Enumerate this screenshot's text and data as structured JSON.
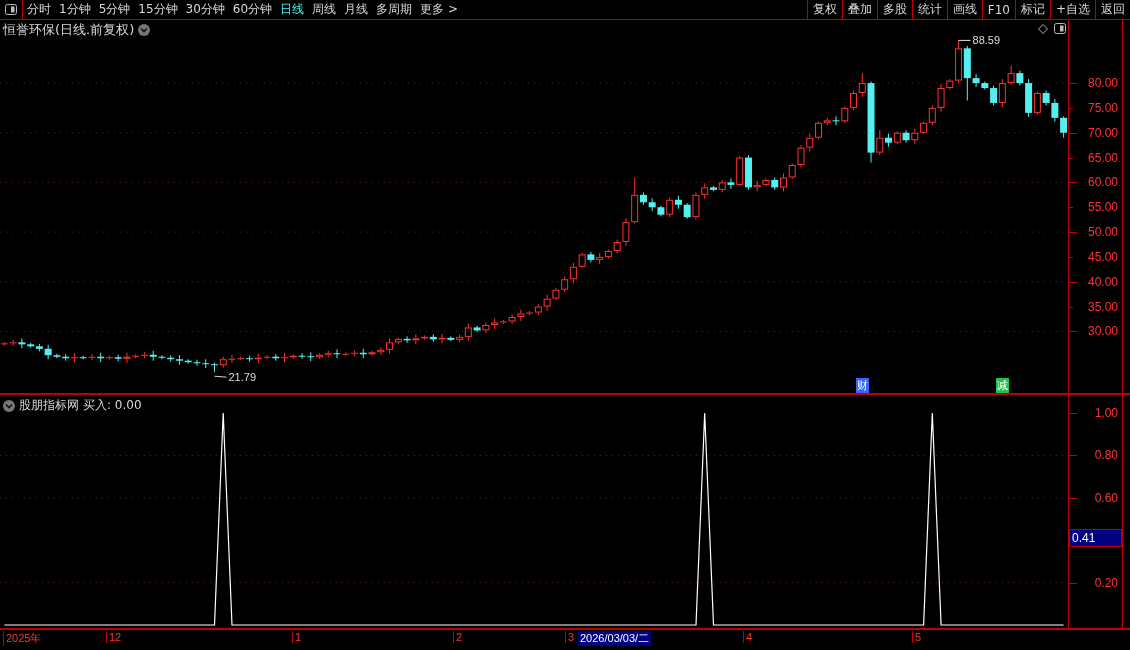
{
  "toolbar": {
    "periods": [
      {
        "label": "分时",
        "selected": false
      },
      {
        "label": "1分钟",
        "selected": false
      },
      {
        "label": "5分钟",
        "selected": false
      },
      {
        "label": "15分钟",
        "selected": false
      },
      {
        "label": "30分钟",
        "selected": false
      },
      {
        "label": "60分钟",
        "selected": false
      },
      {
        "label": "日线",
        "selected": true
      },
      {
        "label": "周线",
        "selected": false
      },
      {
        "label": "月线",
        "selected": false
      },
      {
        "label": "多周期",
        "selected": false
      },
      {
        "label": "更多 >",
        "selected": false
      }
    ],
    "buttons": [
      "复权",
      "叠加",
      "多股",
      "统计",
      "画线",
      "F10",
      "标记",
      "+自选",
      "返回"
    ]
  },
  "price_panel": {
    "title": "恒誉环保(日线.前复权)",
    "chart_data": {
      "type": "candlestick",
      "ylim": [
        17.6,
        92.7
      ],
      "yticks": [
        {
          "value": 80,
          "label": "80.00"
        },
        {
          "value": 75,
          "label": "75.00"
        },
        {
          "value": 70,
          "label": "70.00"
        },
        {
          "value": 65,
          "label": "65.00"
        },
        {
          "value": 60,
          "label": "60.00"
        },
        {
          "value": 55,
          "label": "55.00"
        },
        {
          "value": 50,
          "label": "50.00"
        },
        {
          "value": 45,
          "label": "45.00"
        },
        {
          "value": 40,
          "label": "40.00"
        },
        {
          "value": 35,
          "label": "35.00"
        },
        {
          "value": 30,
          "label": "30.00"
        }
      ],
      "grid": true,
      "ohlc": [
        [
          27.4,
          27.9,
          27.1,
          27.6
        ],
        [
          27.6,
          28.3,
          27.1,
          27.8
        ],
        [
          27.8,
          28.6,
          26.6,
          27.4
        ],
        [
          27.4,
          27.7,
          26.7,
          27.0
        ],
        [
          27.0,
          27.5,
          26.0,
          26.5
        ],
        [
          26.5,
          27.3,
          24.4,
          25.2
        ],
        [
          25.2,
          25.5,
          24.6,
          24.9
        ],
        [
          24.9,
          25.4,
          24.1,
          24.6
        ],
        [
          24.6,
          25.6,
          23.8,
          24.8
        ],
        [
          24.8,
          25.1,
          24.4,
          24.7
        ],
        [
          24.7,
          25.4,
          24.2,
          24.9
        ],
        [
          24.9,
          25.7,
          23.8,
          24.6
        ],
        [
          24.6,
          25.1,
          24.3,
          24.8
        ],
        [
          24.8,
          25.3,
          24.0,
          24.5
        ],
        [
          24.5,
          25.7,
          23.7,
          24.9
        ],
        [
          24.9,
          25.4,
          24.6,
          25.1
        ],
        [
          25.1,
          25.8,
          24.6,
          25.3
        ],
        [
          25.3,
          26.1,
          24.1,
          24.9
        ],
        [
          24.9,
          25.2,
          24.4,
          24.7
        ],
        [
          24.7,
          25.2,
          23.9,
          24.4
        ],
        [
          24.4,
          25.2,
          23.3,
          24.1
        ],
        [
          24.1,
          24.4,
          23.5,
          23.8
        ],
        [
          23.8,
          24.3,
          23.1,
          23.6
        ],
        [
          23.6,
          24.4,
          22.6,
          23.4
        ],
        [
          23.4,
          23.7,
          21.79,
          23.2
        ],
        [
          23.2,
          24.9,
          22.7,
          24.4
        ],
        [
          24.4,
          25.3,
          23.6,
          24.5
        ],
        [
          24.5,
          24.9,
          24.2,
          24.6
        ],
        [
          24.6,
          25.1,
          23.9,
          24.4
        ],
        [
          24.4,
          25.5,
          23.6,
          24.7
        ],
        [
          24.7,
          25.2,
          24.4,
          24.9
        ],
        [
          24.9,
          25.4,
          24.1,
          24.6
        ],
        [
          24.6,
          25.6,
          23.8,
          24.8
        ],
        [
          24.8,
          25.4,
          24.5,
          25.1
        ],
        [
          25.1,
          25.6,
          24.5,
          25.0
        ],
        [
          25.0,
          25.8,
          24.0,
          24.8
        ],
        [
          24.8,
          25.6,
          24.5,
          25.3
        ],
        [
          25.3,
          26.1,
          24.8,
          25.6
        ],
        [
          25.6,
          26.4,
          24.6,
          25.4
        ],
        [
          25.4,
          25.8,
          25.1,
          25.5
        ],
        [
          25.5,
          26.2,
          25.0,
          25.7
        ],
        [
          25.7,
          26.5,
          24.6,
          25.4
        ],
        [
          25.4,
          26.1,
          25.1,
          25.8
        ],
        [
          25.8,
          26.8,
          25.3,
          26.3
        ],
        [
          26.3,
          28.6,
          25.5,
          27.8
        ],
        [
          27.8,
          28.8,
          27.5,
          28.5
        ],
        [
          28.5,
          29.0,
          27.7,
          28.2
        ],
        [
          28.2,
          29.4,
          27.4,
          28.6
        ],
        [
          28.6,
          29.2,
          28.3,
          28.9
        ],
        [
          28.9,
          29.4,
          27.9,
          28.4
        ],
        [
          28.4,
          29.5,
          27.6,
          28.7
        ],
        [
          28.7,
          29.0,
          28.0,
          28.3
        ],
        [
          28.3,
          29.4,
          27.8,
          28.9
        ],
        [
          28.9,
          31.6,
          28.1,
          30.8
        ],
        [
          30.8,
          31.1,
          29.9,
          30.2
        ],
        [
          30.2,
          31.8,
          29.7,
          31.3
        ],
        [
          31.3,
          32.6,
          30.5,
          31.8
        ],
        [
          31.8,
          32.3,
          31.5,
          32.0
        ],
        [
          32.0,
          33.4,
          31.5,
          32.9
        ],
        [
          32.9,
          34.4,
          32.1,
          33.6
        ],
        [
          33.6,
          34.1,
          33.3,
          33.8
        ],
        [
          33.8,
          35.5,
          33.3,
          35.0
        ],
        [
          35.0,
          37.4,
          34.2,
          36.6
        ],
        [
          36.6,
          38.7,
          36.3,
          38.4
        ],
        [
          38.4,
          41.0,
          37.9,
          40.5
        ],
        [
          40.5,
          43.8,
          39.7,
          43.0
        ],
        [
          43.0,
          45.8,
          42.7,
          45.5
        ],
        [
          45.5,
          46.0,
          43.9,
          44.4
        ],
        [
          44.4,
          45.8,
          43.6,
          45.0
        ],
        [
          45.0,
          46.5,
          44.7,
          46.2
        ],
        [
          46.2,
          48.5,
          45.7,
          48.0
        ],
        [
          48.0,
          52.8,
          47.2,
          52.0
        ],
        [
          52.0,
          61.0,
          51.7,
          57.5
        ],
        [
          57.5,
          58.0,
          55.5,
          56.0
        ],
        [
          56.0,
          56.8,
          54.2,
          55.0
        ],
        [
          55.0,
          55.3,
          53.2,
          53.5
        ],
        [
          53.5,
          57.0,
          53.0,
          56.5
        ],
        [
          56.5,
          57.3,
          54.7,
          55.5
        ],
        [
          55.5,
          55.8,
          52.7,
          53.0
        ],
        [
          53.0,
          58.0,
          52.5,
          57.5
        ],
        [
          57.5,
          59.8,
          56.7,
          59.0
        ],
        [
          59.0,
          59.3,
          58.2,
          58.5
        ],
        [
          58.5,
          60.5,
          58.0,
          60.0
        ],
        [
          60.0,
          60.8,
          58.7,
          59.5
        ],
        [
          59.5,
          65.3,
          59.2,
          65.0
        ],
        [
          65.0,
          65.5,
          58.5,
          59.0
        ],
        [
          59.0,
          60.3,
          58.2,
          59.5
        ],
        [
          59.5,
          60.8,
          59.2,
          60.5
        ],
        [
          60.5,
          61.0,
          58.5,
          59.0
        ],
        [
          59.0,
          61.8,
          58.2,
          61.0
        ],
        [
          61.0,
          63.8,
          60.7,
          63.5
        ],
        [
          63.5,
          67.5,
          63.0,
          67.0
        ],
        [
          67.0,
          69.8,
          66.2,
          69.0
        ],
        [
          69.0,
          72.3,
          68.7,
          72.0
        ],
        [
          72.0,
          73.0,
          71.5,
          72.5
        ],
        [
          72.5,
          73.3,
          71.5,
          72.3
        ],
        [
          72.3,
          75.3,
          72.0,
          75.0
        ],
        [
          75.0,
          78.5,
          74.5,
          78.0
        ],
        [
          78.0,
          82.0,
          77.2,
          80.0
        ],
        [
          80.0,
          80.3,
          64.0,
          66.0
        ],
        [
          66.0,
          70.5,
          65.5,
          69.0
        ],
        [
          69.0,
          69.8,
          67.2,
          68.0
        ],
        [
          68.0,
          70.3,
          67.7,
          70.0
        ],
        [
          70.0,
          70.5,
          68.0,
          68.5
        ],
        [
          68.5,
          70.8,
          67.7,
          70.0
        ],
        [
          70.0,
          72.3,
          69.7,
          72.0
        ],
        [
          72.0,
          75.5,
          71.5,
          75.0
        ],
        [
          75.0,
          79.8,
          74.2,
          79.0
        ],
        [
          79.0,
          80.8,
          78.7,
          80.5
        ],
        [
          80.5,
          88.59,
          80.0,
          87.0
        ],
        [
          87.0,
          87.5,
          76.5,
          81.0
        ],
        [
          81.0,
          81.8,
          79.2,
          80.0
        ],
        [
          80.0,
          80.3,
          78.7,
          79.0
        ],
        [
          79.0,
          79.5,
          75.5,
          76.0
        ],
        [
          76.0,
          80.8,
          75.2,
          80.0
        ],
        [
          80.0,
          83.5,
          79.7,
          82.0
        ],
        [
          82.0,
          82.5,
          79.5,
          80.0
        ],
        [
          80.0,
          80.8,
          73.2,
          74.0
        ],
        [
          74.0,
          78.3,
          73.7,
          78.0
        ],
        [
          78.0,
          78.5,
          75.5,
          76.0
        ],
        [
          76.0,
          76.8,
          72.2,
          73.0
        ],
        [
          73.0,
          73.3,
          69.0,
          70.0
        ]
      ],
      "annotations": [
        {
          "text": "88.59"
        },
        {
          "text": "21.79"
        }
      ]
    },
    "events": [
      {
        "label": "财",
        "color": "#3a64ff"
      },
      {
        "label": "减",
        "color": "#22c050"
      }
    ]
  },
  "indicator_panel": {
    "name": "股朋指标网",
    "reading": "买入: 0.00",
    "chart_data": {
      "type": "line",
      "ylim": [
        -0.014,
        1.085
      ],
      "yticks": [
        {
          "value": 1,
          "label": "1.00"
        },
        {
          "value": 0.8,
          "label": "0.80"
        },
        {
          "value": 0.6,
          "label": "0.60"
        },
        {
          "value": 0.2,
          "label": "0.20"
        }
      ],
      "grid": true,
      "series": [
        {
          "color": "#ffffff",
          "values": [
            0,
            0,
            0,
            0,
            0,
            0,
            0,
            0,
            0,
            0,
            0,
            0,
            0,
            0,
            0,
            0,
            0,
            0,
            0,
            0,
            0,
            0,
            0,
            0,
            0,
            1,
            0,
            0,
            0,
            0,
            0,
            0,
            0,
            0,
            0,
            0,
            0,
            0,
            0,
            0,
            0,
            0,
            0,
            0,
            0,
            0,
            0,
            0,
            0,
            0,
            0,
            0,
            0,
            0,
            0,
            0,
            0,
            0,
            0,
            0,
            0,
            0,
            0,
            0,
            0,
            0,
            0,
            0,
            0,
            0,
            0,
            0,
            0,
            0,
            0,
            0,
            0,
            0,
            0,
            0,
            1,
            0,
            0,
            0,
            0,
            0,
            0,
            0,
            0,
            0,
            0,
            0,
            0,
            0,
            0,
            0,
            0,
            0,
            0,
            0,
            0,
            0,
            0,
            0,
            0,
            0,
            1,
            0,
            0,
            0,
            0,
            0,
            0,
            0,
            0,
            0,
            0,
            0,
            0,
            0,
            0,
            0
          ]
        }
      ]
    },
    "cursor": {
      "date": "2026/03/03/二",
      "value": "0.41"
    }
  },
  "date_axis": [
    {
      "label": "2025年"
    },
    {
      "label": "12"
    },
    {
      "label": "1"
    },
    {
      "label": "2"
    },
    {
      "label": "3"
    },
    {
      "label": "4"
    },
    {
      "label": "5"
    }
  ]
}
